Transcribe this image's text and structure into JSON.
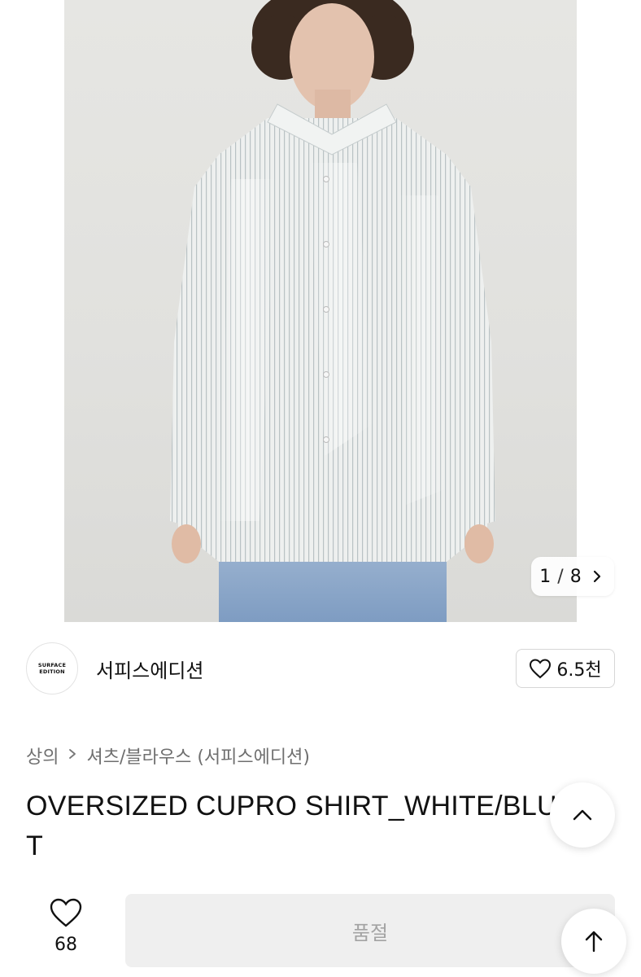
{
  "gallery": {
    "current": "1",
    "separator": "/",
    "total": "8",
    "next_icon": "chevron-right-icon"
  },
  "seller": {
    "logo_text": "SURFACE EDITION",
    "name": "서피스에디션",
    "like_count": "6.5천",
    "like_icon": "heart-outline-icon"
  },
  "category": {
    "main": "상의",
    "separator_icon": "chevron-right-icon",
    "sub": "셔츠/블라우스 (서피스에디션)"
  },
  "product": {
    "title": "OVERSIZED CUPRO SHIRT_WHITE/BLUE ST"
  },
  "floating": {
    "collapse_icon": "chevron-up-icon",
    "scroll_top_icon": "arrow-up-icon"
  },
  "bottom_bar": {
    "wish_icon": "heart-outline-icon",
    "wish_count": "68",
    "action_label": "품절"
  },
  "colors": {
    "soldout_bg": "#efefef",
    "soldout_text": "#a3a3a3",
    "muted_text": "#6f6f6f"
  }
}
